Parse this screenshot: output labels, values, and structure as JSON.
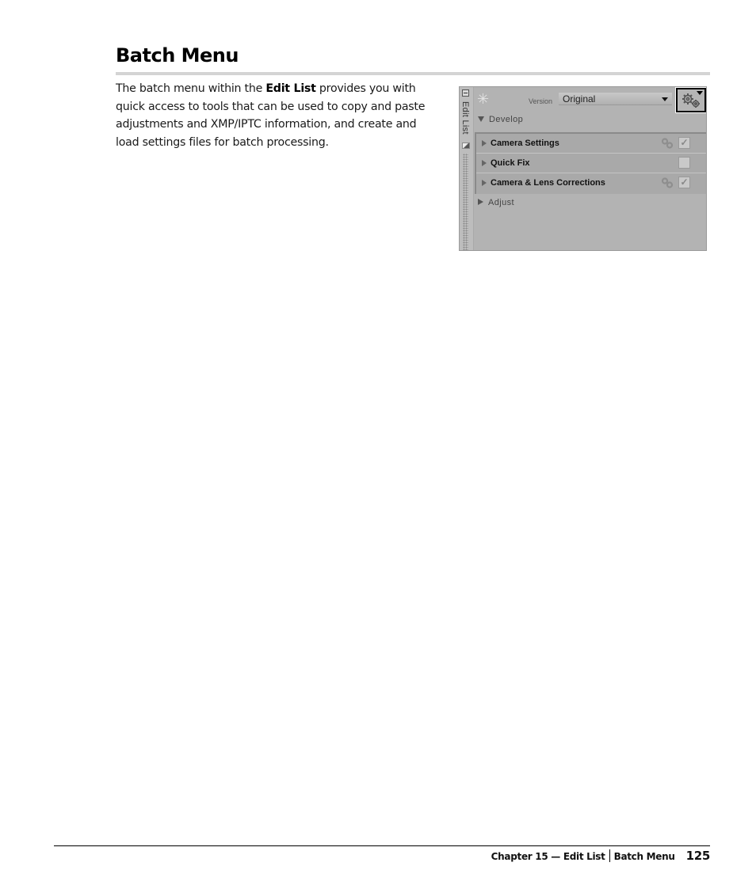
{
  "page": {
    "title": "Batch Menu",
    "body": {
      "before": "The batch menu within the ",
      "bold": "Edit List",
      "after": " provides you with quick access to tools that can be used to copy and paste adjustments and XMP/IPTC information, and create and load settings files for batch processing."
    }
  },
  "panel": {
    "side_label": "Edit List",
    "version_label": "Version",
    "version_value": "Original",
    "sections": {
      "develop": "Develop",
      "adjust": "Adjust"
    },
    "rows": [
      {
        "label": "Camera Settings",
        "linked": true,
        "checked": true,
        "check_glyph": "✓"
      },
      {
        "label": "Quick Fix",
        "linked": false,
        "checked": false,
        "check_glyph": ""
      },
      {
        "label": "Camera & Lens Corrections",
        "linked": true,
        "checked": true,
        "check_glyph": "✓"
      }
    ],
    "icons": {
      "spinner": "✳",
      "gear": "gear-icon",
      "link": "link-icon"
    }
  },
  "footer": {
    "chapter": "Chapter 15 — Edit List",
    "section": "Batch Menu",
    "page_number": "125"
  }
}
